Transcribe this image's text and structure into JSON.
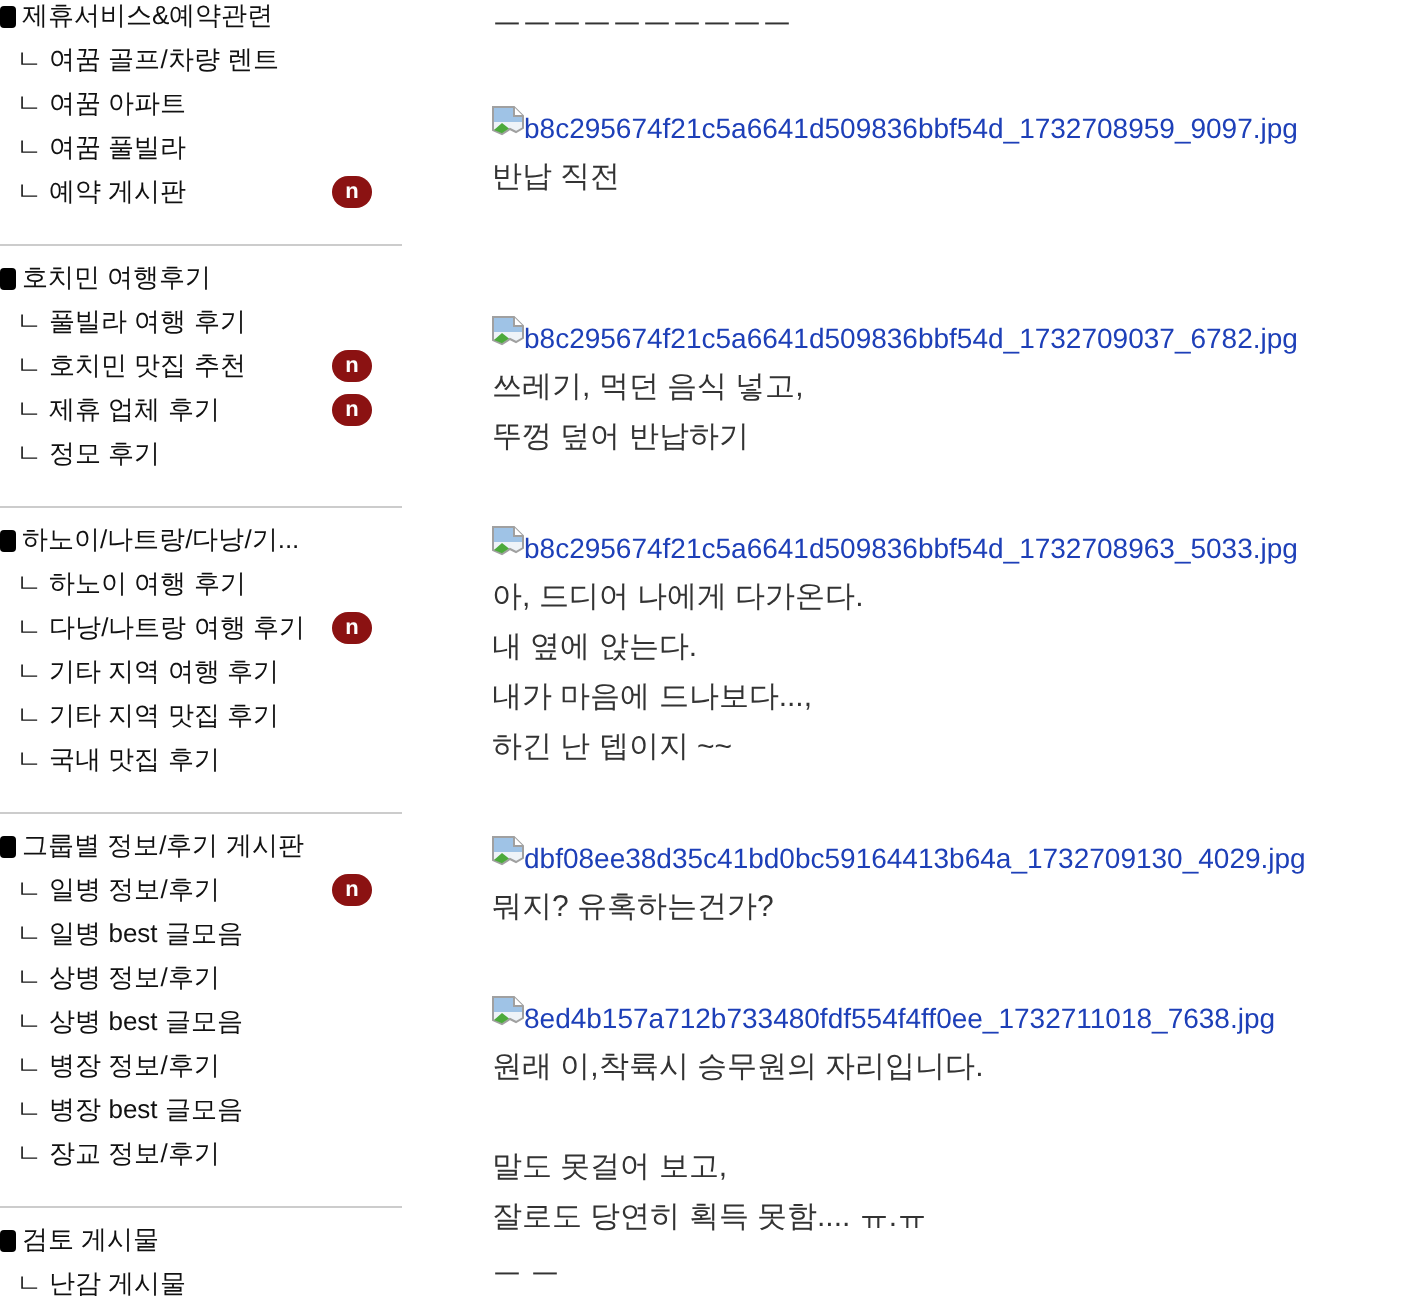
{
  "sidebar": {
    "sections": [
      {
        "title": "제휴서비스&예약관련",
        "items": [
          {
            "label": "ㄴ 여꿈 골프/차량 렌트"
          },
          {
            "label": "ㄴ 여꿈 아파트"
          },
          {
            "label": "ㄴ 여꿈 풀빌라"
          },
          {
            "label": "ㄴ 예약 게시판",
            "badge": "n"
          }
        ]
      },
      {
        "title": "호치민 여행후기",
        "items": [
          {
            "label": "ㄴ 풀빌라 여행 후기"
          },
          {
            "label": "ㄴ 호치민 맛집 추천",
            "badge": "n"
          },
          {
            "label": "ㄴ 제휴 업체 후기",
            "badge": "n"
          },
          {
            "label": "ㄴ 정모 후기"
          }
        ]
      },
      {
        "title": "하노이/나트랑/다낭/기...",
        "items": [
          {
            "label": "ㄴ 하노이 여행 후기"
          },
          {
            "label": "ㄴ 다낭/나트랑 여행 후기",
            "badge": "n"
          },
          {
            "label": "ㄴ 기타 지역 여행 후기"
          },
          {
            "label": "ㄴ 기타 지역 맛집 후기"
          },
          {
            "label": "ㄴ 국내 맛집 후기"
          }
        ]
      },
      {
        "title": "그룹별 정보/후기 게시판",
        "items": [
          {
            "label": "ㄴ 일병 정보/후기",
            "badge": "n"
          },
          {
            "label": "ㄴ 일병 best 글모음"
          },
          {
            "label": "ㄴ 상병 정보/후기"
          },
          {
            "label": "ㄴ 상병 best 글모음"
          },
          {
            "label": "ㄴ 병장 정보/후기"
          },
          {
            "label": "ㄴ 병장 best 글모음"
          },
          {
            "label": "ㄴ 장교 정보/후기"
          }
        ]
      },
      {
        "title": "검토 게시물",
        "items": [
          {
            "label": "ㄴ 난감 게시물"
          }
        ]
      }
    ]
  },
  "post": {
    "blocks": [
      {
        "kind": "text",
        "text": "ㅡㅡㅡㅡㅡㅡㅡㅡㅡㅡ"
      },
      {
        "kind": "blank"
      },
      {
        "kind": "image",
        "alt": "b8c295674f21c5a6641d509836bbf54d_1732708959_9097.jpg"
      },
      {
        "kind": "text",
        "text": "반납 직전"
      },
      {
        "kind": "blank"
      },
      {
        "kind": "blank"
      },
      {
        "kind": "image",
        "alt": "b8c295674f21c5a6641d509836bbf54d_1732709037_6782.jpg"
      },
      {
        "kind": "text",
        "text": "쓰레기, 먹던 음식 넣고,"
      },
      {
        "kind": "text",
        "text": "뚜껑 덮어 반납하기"
      },
      {
        "kind": "blank"
      },
      {
        "kind": "image",
        "alt": "b8c295674f21c5a6641d509836bbf54d_1732708963_5033.jpg"
      },
      {
        "kind": "text",
        "text": "아, 드디어 나에게 다가온다."
      },
      {
        "kind": "text",
        "text": "내 옆에 앉는다."
      },
      {
        "kind": "text",
        "text": "내가 마음에 드나보다...,"
      },
      {
        "kind": "text",
        "text": "하긴 난 뎁이지 ~~"
      },
      {
        "kind": "blank"
      },
      {
        "kind": "image",
        "alt": "dbf08ee38d35c41bd0bc59164413b64a_1732709130_4029.jpg"
      },
      {
        "kind": "text",
        "text": "뭐지? 유혹하는건가?"
      },
      {
        "kind": "blank"
      },
      {
        "kind": "image",
        "alt": "8ed4b157a712b733480fdf554f4ff0ee_1732711018_7638.jpg"
      },
      {
        "kind": "text",
        "text": "원래 이,착륙시 승무원의 자리입니다."
      },
      {
        "kind": "blank"
      },
      {
        "kind": "text",
        "text": "말도 못걸어 보고,"
      },
      {
        "kind": "text",
        "text": "잘로도 당연히 획득 못함.... ㅠ.ㅠ"
      },
      {
        "kind": "text",
        "text": "ㅡ ㅡ"
      }
    ]
  }
}
